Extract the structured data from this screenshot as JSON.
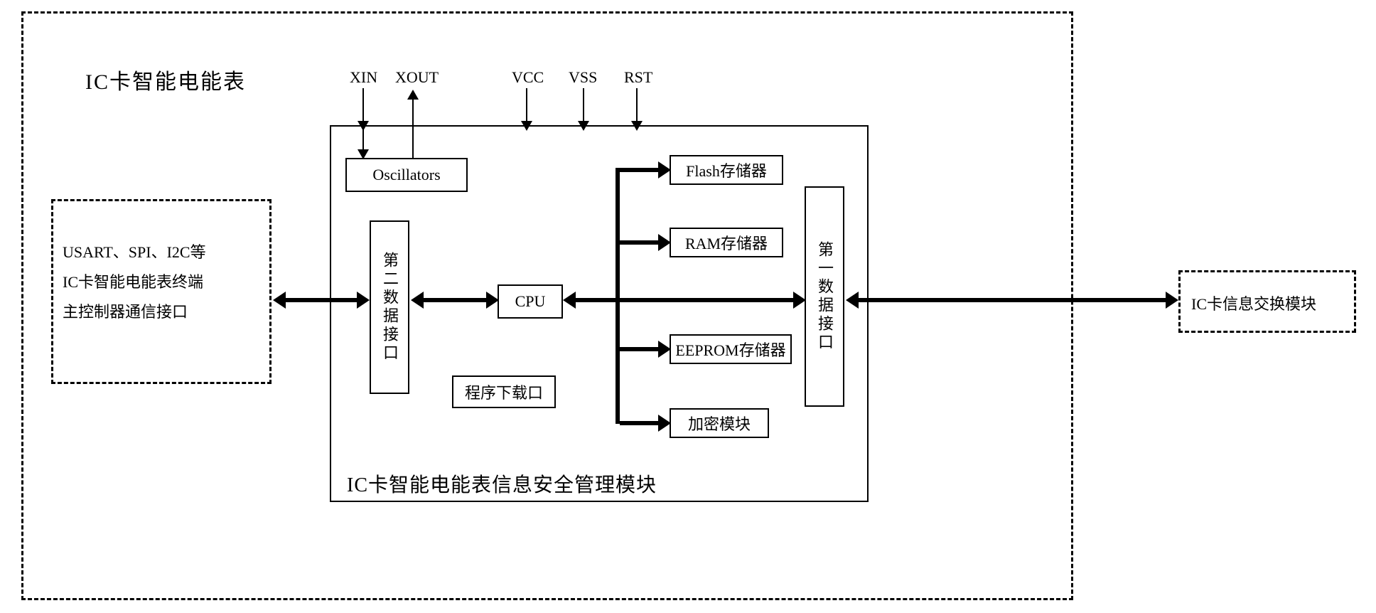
{
  "outer_title": "IC卡智能电能表",
  "left_module": "USART、SPI、I2C等\nIC卡智能电能表终端\n主控制器通信接口",
  "right_module": "IC卡信息交换模块",
  "security_module_title": "IC卡智能电能表信息安全管理模块",
  "pins": {
    "xin": "XIN",
    "xout": "XOUT",
    "vcc": "VCC",
    "vss": "VSS",
    "rst": "RST"
  },
  "blocks": {
    "oscillators": "Oscillators",
    "data_if_2": "第二数据接口",
    "cpu": "CPU",
    "prog_dl": "程序下载口",
    "flash": "Flash存储器",
    "ram": "RAM存储器",
    "eeprom": "EEPROM存储器",
    "encrypt": "加密模块",
    "data_if_1": "第一数据接口"
  }
}
